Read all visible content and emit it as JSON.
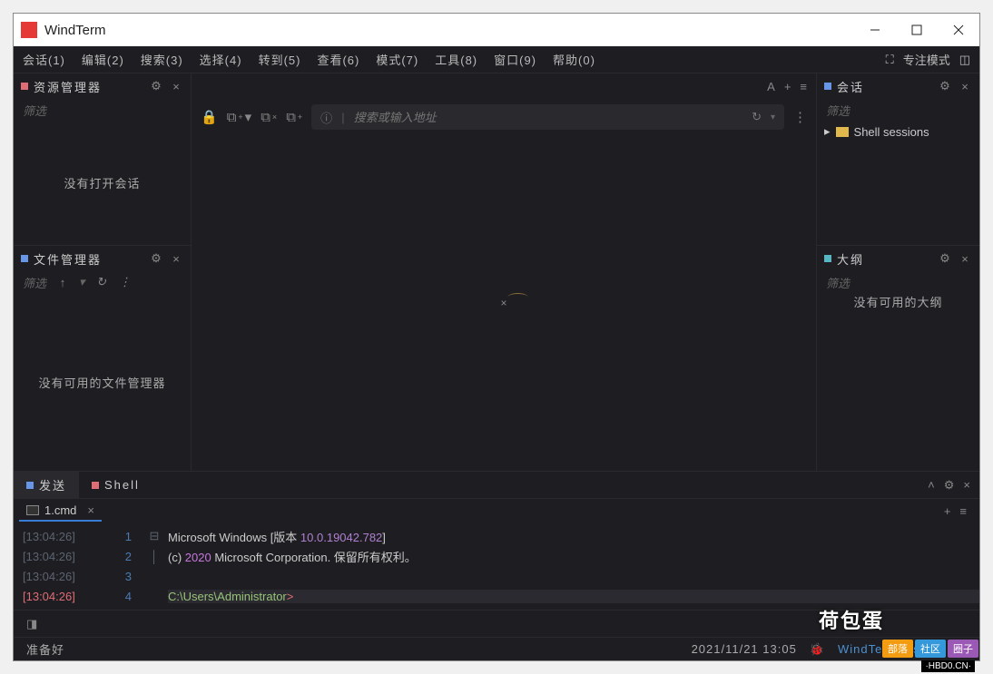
{
  "app": {
    "title": "WindTerm"
  },
  "menu": {
    "items": [
      "会话(1)",
      "编辑(2)",
      "搜索(3)",
      "选择(4)",
      "转到(5)",
      "查看(6)",
      "模式(7)",
      "工具(8)",
      "窗口(9)",
      "帮助(0)"
    ],
    "focus": "专注模式"
  },
  "panels": {
    "resource": {
      "title": "资源管理器",
      "filter": "筛选",
      "empty": "没有打开会话"
    },
    "files": {
      "title": "文件管理器",
      "filter": "筛选",
      "empty": "没有可用的文件管理器"
    },
    "sessions": {
      "title": "会话",
      "filter": "筛选",
      "tree_item": "Shell sessions"
    },
    "outline": {
      "title": "大纲",
      "filter": "筛选",
      "empty": "没有可用的大纲"
    }
  },
  "urlbar": {
    "placeholder": "搜索或输入地址"
  },
  "bottom_tabs": {
    "send": "发送",
    "shell": "Shell"
  },
  "subtab": {
    "label": "1.cmd"
  },
  "terminal": {
    "lines": [
      {
        "ts": "[13:04:26]",
        "n": "1",
        "pre": "Microsoft Windows [版本 ",
        "ver": "10.0.19042.782",
        "post": "]"
      },
      {
        "ts": "[13:04:26]",
        "n": "2",
        "pre": "(c) ",
        "year": "2020",
        "post": " Microsoft Corporation. 保留所有权利。"
      },
      {
        "ts": "[13:04:26]",
        "n": "3",
        "pre": ""
      },
      {
        "ts": "[13:04:26]",
        "n": "4",
        "path": "C:\\Users\\Administrator",
        "gt": ">"
      }
    ]
  },
  "status": {
    "ready": "准备好",
    "datetime": "2021/11/21 13:05",
    "link": "WindTerm Issues"
  },
  "watermark": {
    "big": "荷包蛋",
    "small": "·HBD0.CN·",
    "badges": [
      "部落",
      "社区",
      "圈子"
    ]
  }
}
